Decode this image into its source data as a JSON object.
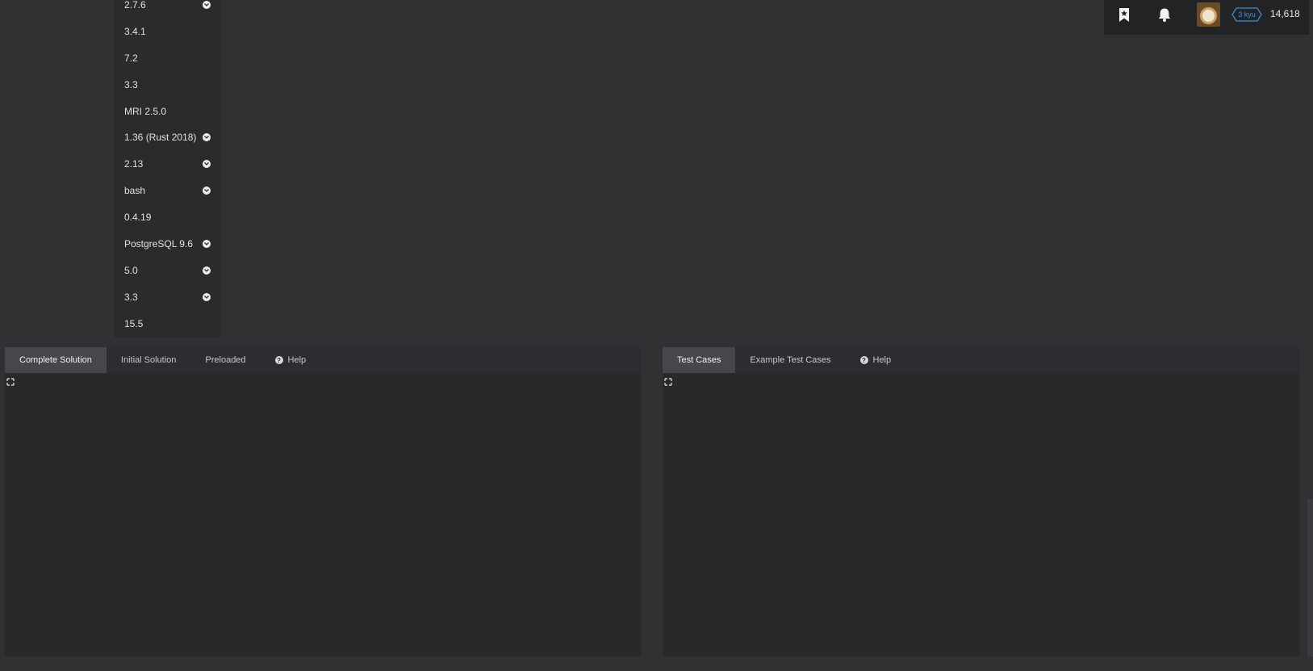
{
  "versions": [
    {
      "label": "2.7.6",
      "has_dropdown": true
    },
    {
      "label": "3.4.1",
      "has_dropdown": false
    },
    {
      "label": "7.2",
      "has_dropdown": false
    },
    {
      "label": "3.3",
      "has_dropdown": false
    },
    {
      "label": "MRI 2.5.0",
      "has_dropdown": false
    },
    {
      "label": "1.36 (Rust 2018)",
      "has_dropdown": true
    },
    {
      "label": "2.13",
      "has_dropdown": true
    },
    {
      "label": "bash",
      "has_dropdown": true
    },
    {
      "label": "0.4.19",
      "has_dropdown": false
    },
    {
      "label": "PostgreSQL 9.6",
      "has_dropdown": true
    },
    {
      "label": "5.0",
      "has_dropdown": true
    },
    {
      "label": "3.3",
      "has_dropdown": true
    },
    {
      "label": "15.5",
      "has_dropdown": false
    }
  ],
  "header": {
    "bookmark_icon": "bookmark-star-icon",
    "bell_icon": "bell-icon",
    "rank": "3 kyu",
    "honor": "14,618",
    "rank_color": "#3a8fd6"
  },
  "solution_panel": {
    "tabs": [
      {
        "label": "Complete Solution",
        "active": true
      },
      {
        "label": "Initial Solution",
        "active": false
      },
      {
        "label": "Preloaded",
        "active": false
      }
    ],
    "help_label": "Help"
  },
  "tests_panel": {
    "tabs": [
      {
        "label": "Test Cases",
        "active": true
      },
      {
        "label": "Example Test Cases",
        "active": false
      }
    ],
    "help_label": "Help"
  },
  "colors": {
    "background": "#303133",
    "panel": "#28292b",
    "active_tab": "#45474b"
  }
}
